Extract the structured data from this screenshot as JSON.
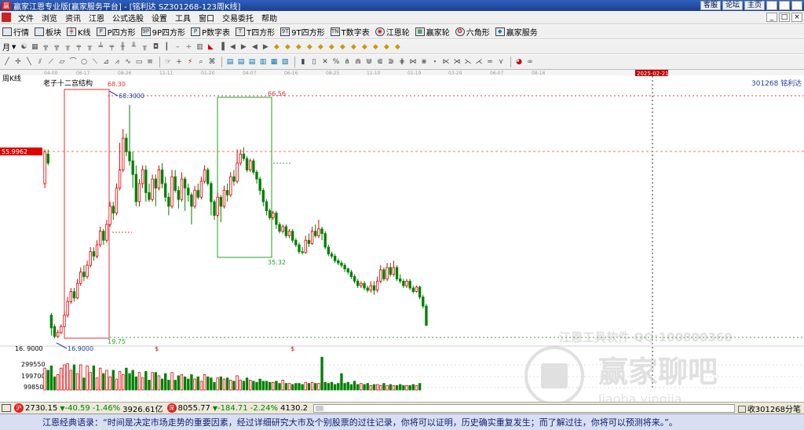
{
  "titlebar": {
    "app_icon": "赢",
    "title": "赢家江恩专业版[赢家服务平台] - [铭利达  SZ301268-123周K线]",
    "links": [
      "客服",
      "论坛",
      "主页"
    ],
    "window_buttons": [
      "_",
      "□",
      "×"
    ]
  },
  "menubar": {
    "items": [
      "文件",
      "浏览",
      "资讯",
      "江恩",
      "公式选股",
      "设置",
      "工具",
      "窗口",
      "交易委托",
      "帮助"
    ],
    "window_buttons": [
      "_",
      "□",
      "×"
    ]
  },
  "toolbar1": {
    "items": [
      {
        "label": "行情",
        "icon": "quote-table-icon"
      },
      {
        "label": "板块",
        "icon": "sector-grid-icon"
      },
      {
        "label": "K线",
        "icon": "candlestick-icon"
      },
      {
        "label": "P四方形",
        "icon": "p-square-icon",
        "glyph": "P"
      },
      {
        "label": "9P四方形",
        "icon": "9p-square-icon",
        "glyph": "9P"
      },
      {
        "label": "P数字表",
        "icon": "p-number-table-icon",
        "glyph": "P"
      },
      {
        "label": "T四方形",
        "icon": "t-square-icon",
        "glyph": "T"
      },
      {
        "label": "9T四方形",
        "icon": "9t-square-icon",
        "glyph": "9T"
      },
      {
        "label": "T数字表",
        "icon": "t-number-table-icon",
        "glyph": "TN"
      },
      {
        "label": "江恩轮",
        "icon": "gann-wheel-icon"
      },
      {
        "label": "赢家轮",
        "icon": "winner-wheel-icon"
      },
      {
        "label": "六角形",
        "icon": "hexagon-icon"
      },
      {
        "label": "赢家服务",
        "icon": "winner-service-icon"
      }
    ]
  },
  "toolbar2": {
    "period": "月",
    "period_arrow": "▼"
  },
  "colors": {
    "up": "#e00000",
    "down": "#008000",
    "box_red": "#e03030",
    "box_green": "#20a020",
    "price_tag_bg": "#e00000",
    "date_tag_bg": "#c00000",
    "watermark": "#c8c8c8"
  },
  "chart_data": {
    "type": "candlestick",
    "period_label": "周K线",
    "structure_label": "老子十二宫结构",
    "stock_label": "301268  铭利达",
    "price_tag": "55.9962",
    "date_tag": "2025-02-21",
    "date_ticks": [
      "04-00",
      "06-17",
      "08-26",
      "11-11",
      "01-20",
      "04-07",
      "06-16",
      "08-25",
      "11-10",
      "01-19",
      "03-29",
      "06-07",
      "08-16"
    ],
    "price_annotations": [
      "68.30",
      "68.3000",
      "66.56",
      "35.32",
      "19.75",
      "16.9000",
      "16. 9000"
    ],
    "volume_ticks": [
      "299550",
      "199700",
      "99850"
    ],
    "dollar_markers": [
      "$",
      "$"
    ],
    "ylim": [
      14,
      70
    ],
    "candles": [
      [
        51.0,
        58.0,
        58.5,
        50.0
      ],
      [
        57.5,
        55.5,
        58.5,
        55.0
      ],
      [
        22.0,
        19.2,
        22.5,
        17.5
      ],
      [
        19.5,
        17.3,
        20.0,
        16.9
      ],
      [
        17.3,
        18.2,
        18.8,
        17.0
      ],
      [
        18.2,
        19.5,
        20.0,
        17.8
      ],
      [
        19.5,
        22.0,
        22.8,
        19.3
      ],
      [
        22.0,
        25.0,
        26.0,
        21.5
      ],
      [
        25.0,
        27.2,
        28.0,
        24.5
      ],
      [
        27.2,
        25.8,
        28.0,
        25.0
      ],
      [
        25.8,
        29.0,
        30.0,
        25.5
      ],
      [
        29.0,
        31.5,
        32.5,
        28.5
      ],
      [
        31.5,
        30.5,
        33.0,
        29.5
      ],
      [
        30.5,
        33.0,
        34.0,
        30.0
      ],
      [
        33.0,
        36.0,
        37.0,
        32.5
      ],
      [
        36.0,
        35.0,
        37.0,
        34.0
      ],
      [
        35.0,
        37.5,
        38.5,
        34.5
      ],
      [
        37.5,
        40.5,
        41.5,
        37.0
      ],
      [
        40.5,
        38.5,
        41.0,
        37.5
      ],
      [
        38.5,
        42.0,
        43.0,
        38.0
      ],
      [
        42.0,
        46.0,
        47.0,
        41.5
      ],
      [
        46.0,
        44.5,
        47.0,
        43.0
      ],
      [
        44.5,
        50.0,
        51.0,
        44.0
      ],
      [
        50.0,
        54.0,
        60.0,
        49.5
      ],
      [
        54.0,
        61.0,
        63.0,
        53.5
      ],
      [
        61.0,
        58.0,
        62.0,
        57.0
      ],
      [
        58.0,
        56.0,
        68.3,
        55.0
      ],
      [
        56.0,
        53.0,
        58.0,
        50.0
      ],
      [
        53.0,
        47.0,
        55.0,
        46.0
      ],
      [
        47.0,
        51.0,
        52.0,
        46.0
      ],
      [
        51.0,
        54.0,
        55.0,
        50.0
      ],
      [
        54.0,
        49.0,
        55.0,
        47.0
      ],
      [
        49.0,
        47.5,
        51.0,
        47.0
      ],
      [
        47.5,
        52.0,
        53.0,
        47.0
      ],
      [
        52.0,
        50.0,
        53.0,
        46.0
      ],
      [
        50.0,
        54.0,
        55.0,
        49.5
      ],
      [
        54.0,
        51.0,
        55.5,
        50.0
      ],
      [
        51.0,
        48.0,
        52.5,
        47.0
      ],
      [
        48.0,
        46.0,
        49.0,
        44.0
      ],
      [
        46.0,
        52.5,
        54.0,
        45.5
      ],
      [
        52.5,
        49.5,
        54.0,
        49.0
      ],
      [
        49.5,
        47.5,
        50.5,
        45.5
      ],
      [
        47.5,
        52.0,
        53.5,
        47.0
      ],
      [
        52.0,
        50.0,
        52.5,
        45.0
      ],
      [
        50.0,
        48.5,
        51.0,
        47.0
      ],
      [
        48.5,
        46.0,
        49.0,
        42.0
      ],
      [
        46.0,
        49.5,
        50.5,
        45.5
      ],
      [
        49.5,
        48.0,
        51.0,
        47.5
      ],
      [
        48.0,
        51.5,
        52.5,
        47.5
      ],
      [
        51.5,
        54.0,
        55.0,
        51.0
      ],
      [
        54.0,
        51.0,
        54.5,
        50.5
      ],
      [
        51.0,
        47.0,
        51.5,
        44.0
      ],
      [
        47.0,
        44.0,
        47.5,
        43.0
      ],
      [
        44.0,
        48.0,
        49.0,
        43.5
      ],
      [
        48.0,
        46.0,
        48.5,
        42.5
      ],
      [
        46.0,
        49.5,
        50.5,
        45.5
      ],
      [
        49.5,
        48.5,
        51.0,
        47.0
      ],
      [
        48.5,
        52.5,
        53.5,
        48.0
      ],
      [
        52.5,
        51.5,
        54.0,
        50.5
      ],
      [
        51.5,
        55.5,
        58.5,
        51.0
      ],
      [
        55.5,
        57.5,
        58.5,
        55.0
      ],
      [
        57.5,
        56.5,
        59.0,
        56.0
      ],
      [
        56.5,
        54.0,
        57.0,
        53.5
      ],
      [
        54.0,
        56.0,
        56.5,
        53.5
      ],
      [
        56.0,
        53.5,
        56.5,
        53.0
      ],
      [
        53.5,
        52.0,
        54.0,
        51.0
      ],
      [
        52.0,
        49.5,
        52.5,
        48.5
      ],
      [
        49.5,
        47.0,
        50.0,
        46.0
      ],
      [
        47.0,
        45.0,
        47.5,
        44.0
      ],
      [
        45.0,
        43.5,
        45.5,
        43.0
      ],
      [
        43.5,
        44.5,
        45.0,
        43.0
      ],
      [
        44.5,
        42.0,
        45.0,
        41.0
      ],
      [
        42.0,
        40.5,
        42.5,
        40.0
      ],
      [
        40.5,
        41.5,
        42.0,
        40.0
      ],
      [
        41.5,
        39.5,
        42.0,
        39.0
      ],
      [
        39.5,
        40.5,
        41.0,
        39.0
      ],
      [
        40.5,
        38.5,
        41.0,
        38.0
      ],
      [
        38.5,
        37.5,
        39.0,
        37.0
      ],
      [
        37.5,
        36.0,
        38.0,
        35.5
      ],
      [
        36.0,
        35.8,
        37.0,
        35.32
      ],
      [
        35.8,
        38.5,
        39.5,
        35.5
      ],
      [
        38.5,
        37.8,
        40.0,
        37.0
      ],
      [
        37.8,
        40.5,
        41.5,
        37.5
      ],
      [
        40.5,
        39.5,
        42.0,
        39.0
      ],
      [
        39.5,
        41.0,
        43.0,
        39.0
      ],
      [
        41.0,
        40.0,
        41.5,
        38.5
      ],
      [
        40.0,
        37.0,
        40.5,
        36.5
      ],
      [
        37.0,
        35.5,
        37.5,
        35.0
      ],
      [
        35.5,
        35.0,
        36.0,
        34.5
      ],
      [
        35.0,
        34.0,
        35.5,
        33.5
      ],
      [
        34.0,
        33.5,
        34.5,
        33.0
      ],
      [
        33.5,
        33.0,
        34.0,
        32.5
      ],
      [
        33.0,
        32.2,
        33.5,
        31.5
      ],
      [
        32.2,
        31.5,
        32.5,
        31.0
      ],
      [
        31.5,
        30.5,
        32.0,
        30.0
      ],
      [
        30.5,
        29.5,
        31.0,
        29.0
      ],
      [
        29.5,
        28.5,
        30.0,
        28.0
      ],
      [
        28.5,
        29.0,
        29.5,
        28.0
      ],
      [
        29.0,
        28.0,
        29.5,
        27.5
      ],
      [
        28.0,
        27.5,
        28.5,
        27.0
      ],
      [
        27.5,
        28.5,
        29.5,
        27.0
      ],
      [
        28.5,
        27.5,
        29.5,
        26.5
      ],
      [
        27.5,
        29.5,
        30.5,
        27.0
      ],
      [
        29.5,
        32.0,
        33.0,
        29.0
      ],
      [
        32.0,
        30.0,
        32.5,
        29.5
      ],
      [
        30.0,
        32.5,
        33.5,
        29.5
      ],
      [
        32.5,
        31.0,
        33.5,
        30.5
      ],
      [
        31.0,
        32.5,
        34.0,
        30.5
      ],
      [
        32.5,
        30.0,
        33.0,
        29.5
      ],
      [
        30.0,
        29.5,
        31.0,
        29.0
      ],
      [
        29.5,
        28.5,
        30.0,
        28.0
      ],
      [
        28.5,
        29.5,
        30.0,
        28.0
      ],
      [
        29.5,
        28.0,
        30.0,
        27.5
      ],
      [
        28.0,
        27.2,
        28.5,
        26.8
      ],
      [
        27.2,
        28.2,
        28.5,
        27.0
      ],
      [
        28.2,
        26.0,
        28.5,
        25.5
      ],
      [
        26.0,
        24.0,
        26.5,
        23.5
      ],
      [
        24.0,
        19.8,
        24.5,
        19.6
      ]
    ],
    "volumes": [
      200000,
      180000,
      220000,
      120000,
      140000,
      200000,
      230000,
      240000,
      180000,
      230000,
      150000,
      230000,
      110000,
      220000,
      160000,
      220000,
      110000,
      200000,
      150000,
      180000,
      120000,
      180000,
      100000,
      170000,
      140000,
      200000,
      150000,
      180000,
      120000,
      160000,
      110000,
      170000,
      90000,
      160000,
      160000,
      130000,
      100000,
      150000,
      90000,
      160000,
      90000,
      130000,
      140000,
      120000,
      100000,
      140000,
      100000,
      120000,
      80000,
      140000,
      120000,
      110000,
      70000,
      110000,
      120000,
      100000,
      110000,
      90000,
      80000,
      130000,
      90000,
      80000,
      110000,
      90000,
      80000,
      70000,
      100000,
      80000,
      80000,
      70000,
      70000,
      80000,
      60000,
      90000,
      60000,
      60000,
      50000,
      60000,
      60000,
      50000,
      70000,
      60000,
      70000,
      60000,
      60000,
      300000,
      70000,
      60000,
      70000,
      50000,
      60000,
      150000,
      60000,
      70000,
      50000,
      80000,
      50000,
      60000,
      50000,
      60000,
      40000,
      50000,
      50000,
      40000,
      60000,
      40000,
      50000,
      40000,
      40000,
      50000,
      40000,
      40000,
      40000,
      50000,
      40000,
      60000
    ],
    "vol_max": 330000
  },
  "watermark": {
    "line1": "江恩工具软件  QQ:100800360",
    "line2": "赢家聊吧",
    "line3": "liaoba.yingjia"
  },
  "statusbar": {
    "badge1": "沪",
    "sh_index": "2730.15",
    "sh_change": "-40.59",
    "sh_pct": "-1.46%",
    "sh_amount": "3926.61亿",
    "badge2": "深",
    "sz_index": "8055.77",
    "sz_change": "-184.71",
    "sz_pct": "-2.24%",
    "sz_amount": "4130.2",
    "right_text": "收301268分笔"
  },
  "footer": {
    "quote": "江恩经典语录：“时间是决定市场走势的重要因素，经过详细研究大市及个别股票的过往记录，你将可以证明，历史确实重复发生；而了解过往，你将可以预测将来。”。"
  }
}
